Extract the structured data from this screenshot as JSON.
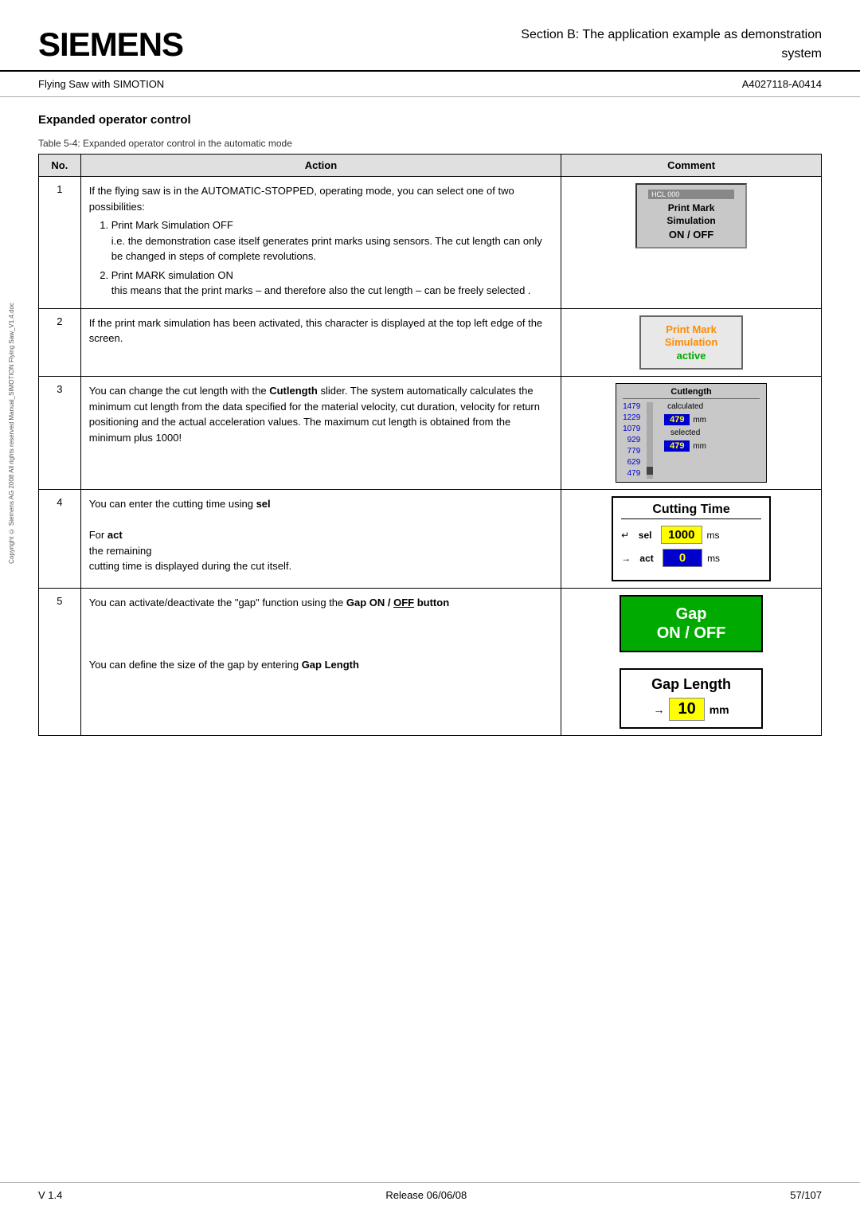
{
  "header": {
    "logo": "SIEMENS",
    "title_line1": "Section B:  The application example as demonstration",
    "title_line2": "system"
  },
  "subheader": {
    "left": "Flying Saw with SIMOTION",
    "right": "A4027118-A0414"
  },
  "section": {
    "title": "Expanded operator control",
    "table_caption": "Table 5-4: Expanded operator control in the automatic mode"
  },
  "table": {
    "col_no": "No.",
    "col_action": "Action",
    "col_comment": "Comment",
    "rows": [
      {
        "no": "1",
        "action_intro": "If the flying saw is in the AUTOMATIC-STOPPED, operating mode, you can select one of two possibilities:",
        "action_items": [
          "Print Mark Simulation OFF\ni.e. the demonstration case itself generates print marks using sensors. The cut length can only be changed in steps of complete revolutions.",
          "Print MARK simulation ON\nthis means that the print marks – and therefore also the cut length – can be freely selected ."
        ],
        "comment_type": "print_mark_onoff"
      },
      {
        "no": "2",
        "action": "If the print mark simulation has been activated, this character is displayed at the top left edge of the screen.",
        "comment_type": "print_mark_active"
      },
      {
        "no": "3",
        "action_intro": "You can change the cut length with the ",
        "action_bold": "Cutlength",
        "action_rest": " slider. The system automatically calculates the minimum cut length from the data specified for the material velocity, cut duration, velocity for return positioning and the actual acceleration values.  The maximum cut length is obtained from the minimum plus 1000!",
        "comment_type": "cutlength"
      },
      {
        "no": "4",
        "action_top": "You can enter the cutting time using sel",
        "action_for": "For act",
        "action_remaining": "the remaining",
        "action_bottom": "cutting time is displayed during the cut itself.",
        "comment_type": "cutting_time"
      },
      {
        "no": "5",
        "action_top": "You can activate/deactivate the \"gap\" function using the",
        "action_bold": "Gap ON / OFF button",
        "action_define": "You can define the size of the gap by entering",
        "action_define_bold": "Gap Length",
        "comment_type": "gap"
      }
    ]
  },
  "widgets": {
    "print_mark_onoff": {
      "addr": "HCL  000",
      "title_line1": "Print Mark",
      "title_line2": "Simulation",
      "onoff": "ON / OFF"
    },
    "print_mark_active": {
      "line1": "Print Mark",
      "line2": "Simulation",
      "line3": "active"
    },
    "cutlength": {
      "title": "Cutlength",
      "scale": [
        "1479",
        "1229",
        "1079",
        "929",
        "779",
        "629",
        "479"
      ],
      "calculated_label": "calculated",
      "calculated_value": "479",
      "calculated_unit": "mm",
      "selected_label": "selected",
      "selected_value": "479",
      "selected_unit": "mm"
    },
    "cutting_time": {
      "title": "Cutting Time",
      "sel_label": "sel",
      "sel_arrow": "↵",
      "sel_value": "1000",
      "sel_unit": "ms",
      "act_label": "act",
      "act_arrow": "→",
      "act_value": "0",
      "act_unit": "ms"
    },
    "gap": {
      "btn_line1": "Gap",
      "btn_line2": "ON / OFF",
      "length_title": "Gap Length",
      "length_arrow": "→",
      "length_value": "10",
      "length_unit": "mm"
    }
  },
  "footer": {
    "version": "V 1.4",
    "release": "Release 06/06/08",
    "page": "57/107"
  },
  "copyright": "Copyright © Siemens AG 2008 All rights reserved\nManual_SIMOTION Flying Saw_V1.4.doc"
}
